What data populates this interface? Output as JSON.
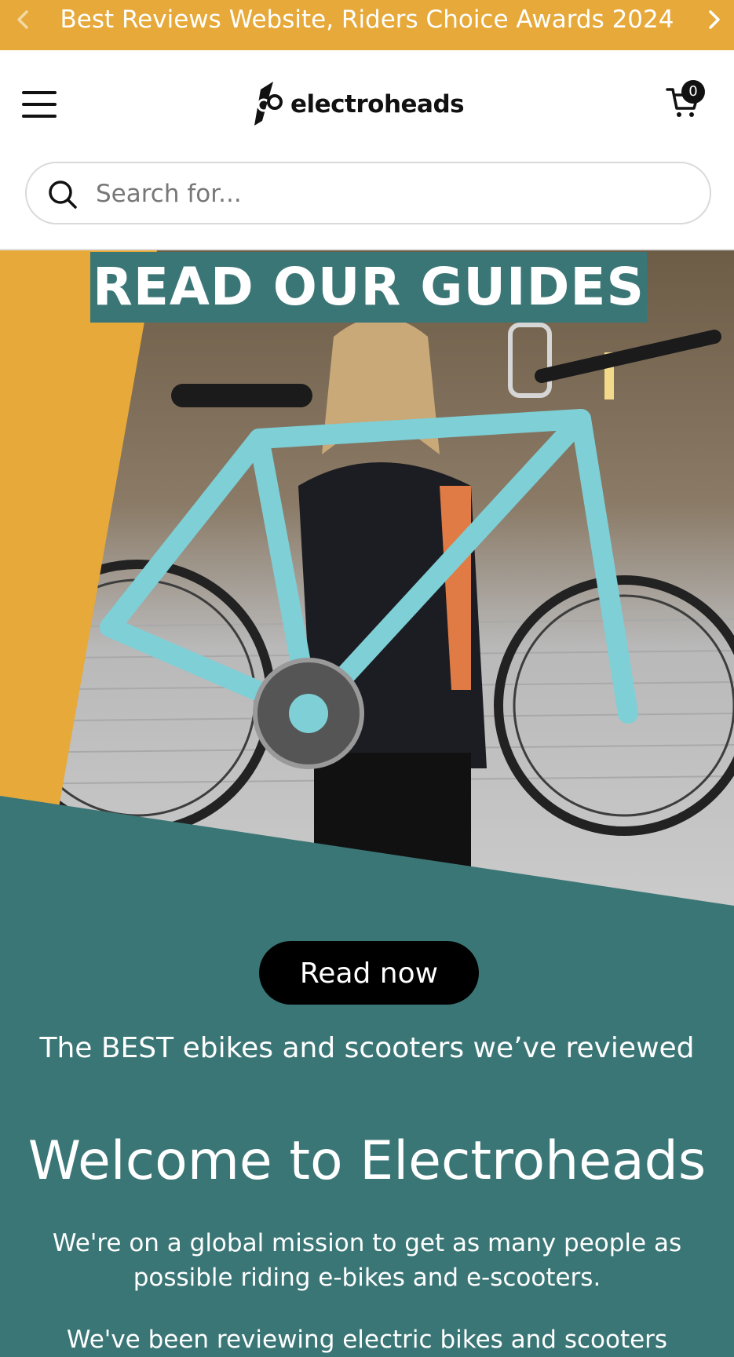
{
  "announcement": {
    "text": "Best Reviews Website, Riders Choice Awards 2024",
    "prev_icon": "chevron-left-icon",
    "next_icon": "chevron-right-icon"
  },
  "header": {
    "logo_text": "electroheads",
    "cart_count": "0",
    "search_placeholder": "Search for..."
  },
  "hero": {
    "banner": "READ OUR GUIDES",
    "button": "Read now",
    "tagline": "The BEST ebikes and scooters we’ve reviewed"
  },
  "intro": {
    "heading": "Welcome to Electroheads",
    "mission": "We're on a global mission to get as many people as possible riding e-bikes and e-scooters.",
    "reviewing": "We've been reviewing electric bikes and scooters"
  },
  "colors": {
    "accent_yellow": "#e6a93a",
    "teal": "#3b7676"
  }
}
